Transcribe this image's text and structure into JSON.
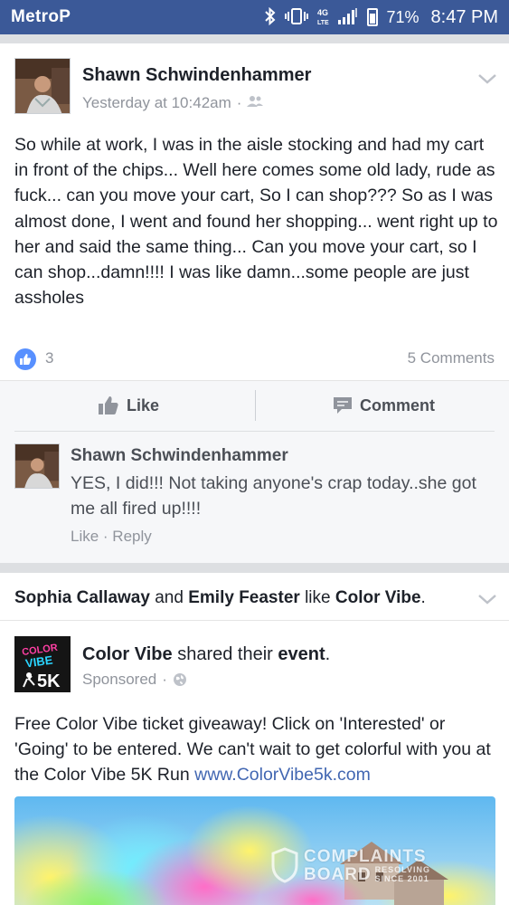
{
  "status_bar": {
    "carrier": "MetroP",
    "carrier_fade": "·",
    "battery": "71%",
    "time": "8:47 PM"
  },
  "post1": {
    "author": "Shawn Schwindenhammer",
    "timestamp": "Yesterday at 10:42am",
    "text": "So while at work, I was in the aisle stocking and had my cart in front of the chips... Well here comes some old lady, rude as fuck... can you move your cart, So I can shop??? So as I was almost done, I went and found her shopping... went right up to her and said the same thing... Can you move your cart, so I can shop...damn!!!! I was like damn...some people are just assholes",
    "likes": "3",
    "comments_count": "5 Comments",
    "actions": {
      "like": "Like",
      "comment": "Comment"
    },
    "comment": {
      "author": "Shawn Schwindenhammer",
      "text": "YES, I did!!! Not taking anyone's crap today..she got me all fired up!!!!",
      "like": "Like",
      "separator": " · ",
      "reply": "Reply"
    }
  },
  "post2": {
    "story": {
      "user1": "Sophia Callaway",
      "and": " and ",
      "user2": "Emily Feaster",
      "like": " like ",
      "page": "Color Vibe",
      "period": "."
    },
    "page_name": "Color Vibe",
    "shared": " shared their ",
    "event": "event",
    "period": ".",
    "sponsored": "Sponsored",
    "text": "Free Color Vibe ticket giveaway! Click on 'Interested' or 'Going' to be entered. We can't wait to get colorful with you at the Color Vibe 5K Run ",
    "link": "www.ColorVibe5k.com",
    "logo_text": {
      "line1": "COLOR",
      "line2": "VIBE",
      "line3": "5K"
    },
    "watermark": {
      "line1": "COMPLAINTS",
      "line2": "BOARD",
      "line3": "RESOLVING",
      "line4": "SINCE 2001"
    }
  },
  "colors": {
    "facebook_blue": "#3b5998",
    "link_blue": "#4267b2",
    "like_blue": "#5890ff",
    "secondary_text": "#90949c"
  }
}
